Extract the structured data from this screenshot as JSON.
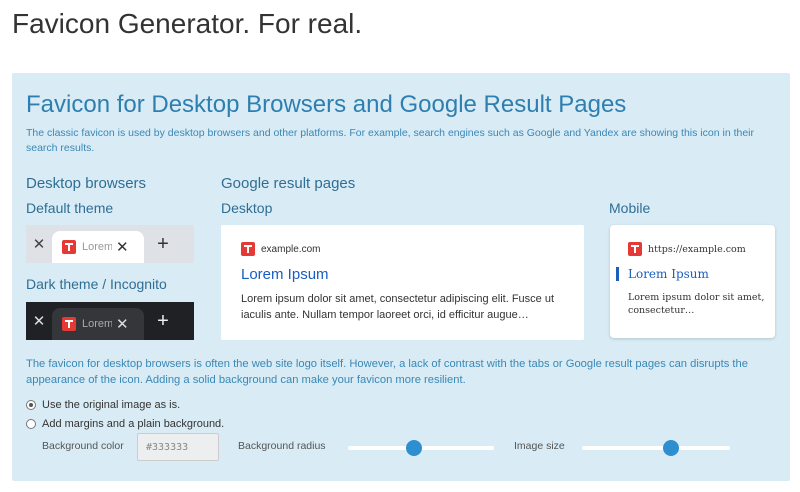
{
  "page": {
    "title": "Favicon Generator. For real."
  },
  "panel": {
    "title": "Favicon for Desktop Browsers and Google Result Pages",
    "description": "The classic favicon is used by desktop browsers and other platforms. For example, search engines such as Google and Yandex are showing this icon in their search results."
  },
  "desktop": {
    "heading": "Desktop browsers",
    "default_theme_label": "Default theme",
    "dark_theme_label": "Dark theme / Incognito",
    "tab_text": "Lorem Ipsum",
    "close_glyph": "✕",
    "plus_glyph": "+"
  },
  "google": {
    "heading": "Google result pages",
    "desktop_label": "Desktop",
    "mobile_label": "Mobile",
    "desktop_result": {
      "site": "example.com",
      "title": "Lorem Ipsum",
      "snippet": "Lorem ipsum dolor sit amet, consectetur adipiscing elit. Fusce ut iaculis ante. Nullam tempor laoreet orci, id efficitur augue…"
    },
    "mobile_result": {
      "site": "https://example.com",
      "title": "Lorem Ipsum",
      "snippet": "Lorem ipsum dolor sit amet, consectetur…"
    }
  },
  "settings": {
    "note": "The favicon for desktop browsers is often the web site logo itself. However, a lack of contrast with the tabs or Google result pages can disrupts the appearance of the icon. Adding a solid background can make your favicon more resilient.",
    "option_original": "Use the original image as is.",
    "option_margins": "Add margins and a plain background.",
    "selected_option": "original",
    "background_color_label": "Background color",
    "background_color_value": "#333333",
    "background_radius_label": "Background radius",
    "background_radius_level": 0.45,
    "image_size_label": "Image size",
    "image_size_level": 0.6
  },
  "colors": {
    "accent": "#2e7fb0",
    "panel_bg": "#d9ecf5",
    "favicon": "#e53935",
    "slider": "#2e8fd0"
  },
  "icons": {
    "favicon": "favicon-icon",
    "close": "close-icon",
    "plus": "plus-icon"
  }
}
